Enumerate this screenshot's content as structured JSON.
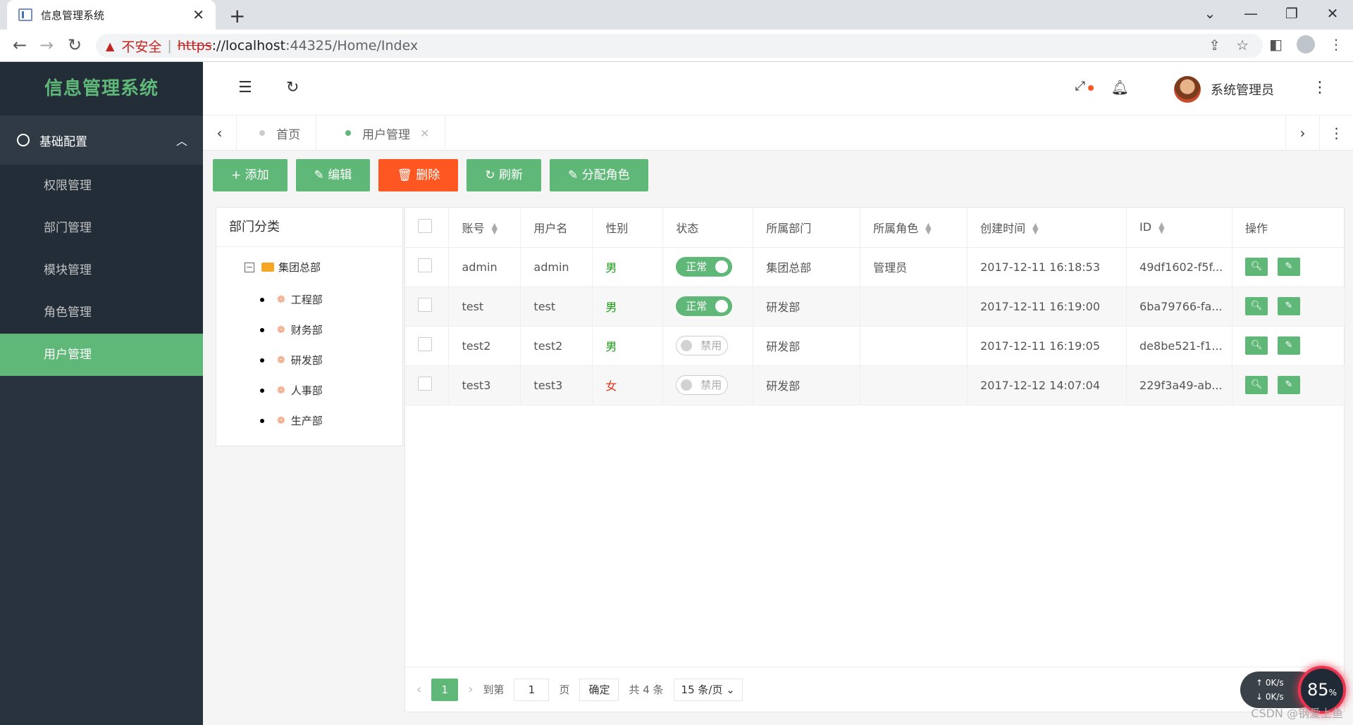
{
  "browser": {
    "tab_title": "信息管理系统",
    "insecure_label": "不安全",
    "url_scheme": "https",
    "url_host": "://localhost",
    "url_path": ":44325/Home/Index"
  },
  "sidebar": {
    "logo": "信息管理系统",
    "group": "基础配置",
    "items": [
      {
        "label": "权限管理"
      },
      {
        "label": "部门管理"
      },
      {
        "label": "模块管理"
      },
      {
        "label": "角色管理"
      },
      {
        "label": "用户管理",
        "active": true
      }
    ]
  },
  "header": {
    "user_name": "系统管理员"
  },
  "tabs": [
    {
      "label": "首页",
      "active": false
    },
    {
      "label": "用户管理",
      "active": true
    }
  ],
  "toolbar": {
    "add": "+ 添加",
    "edit": "✎ 编辑",
    "delete": "🗑 删除",
    "refresh": "↻ 刷新",
    "assign_role": "✎ 分配角色"
  },
  "dept_panel": {
    "title": "部门分类",
    "root": "集团总部",
    "children": [
      "工程部",
      "财务部",
      "研发部",
      "人事部",
      "生产部"
    ]
  },
  "table": {
    "columns": [
      "账号",
      "用户名",
      "性别",
      "状态",
      "所属部门",
      "所属角色",
      "创建时间",
      "ID",
      "操作"
    ],
    "rows": [
      {
        "account": "admin",
        "username": "admin",
        "gender": "男",
        "status": "正常",
        "dept": "集团总部",
        "role": "管理员",
        "created": "2017-12-11 16:18:53",
        "id": "49df1602-f5f..."
      },
      {
        "account": "test",
        "username": "test",
        "gender": "男",
        "status": "正常",
        "dept": "研发部",
        "role": "",
        "created": "2017-12-11 16:19:00",
        "id": "6ba79766-fa..."
      },
      {
        "account": "test2",
        "username": "test2",
        "gender": "男",
        "status": "禁用",
        "dept": "研发部",
        "role": "",
        "created": "2017-12-11 16:19:05",
        "id": "de8be521-f1..."
      },
      {
        "account": "test3",
        "username": "test3",
        "gender": "女",
        "status": "禁用",
        "dept": "研发部",
        "role": "",
        "created": "2017-12-12 14:07:04",
        "id": "229f3a49-ab..."
      }
    ]
  },
  "pager": {
    "current": "1",
    "goto_label": "到第",
    "goto_value": "1",
    "page_label": "页",
    "confirm": "确定",
    "total": "共 4 条",
    "per_page": "15 条/页"
  },
  "speed": {
    "up": "0K/s",
    "down": "0K/s",
    "percent": "85"
  },
  "watermark": "CSDN @钢爱上鱼"
}
